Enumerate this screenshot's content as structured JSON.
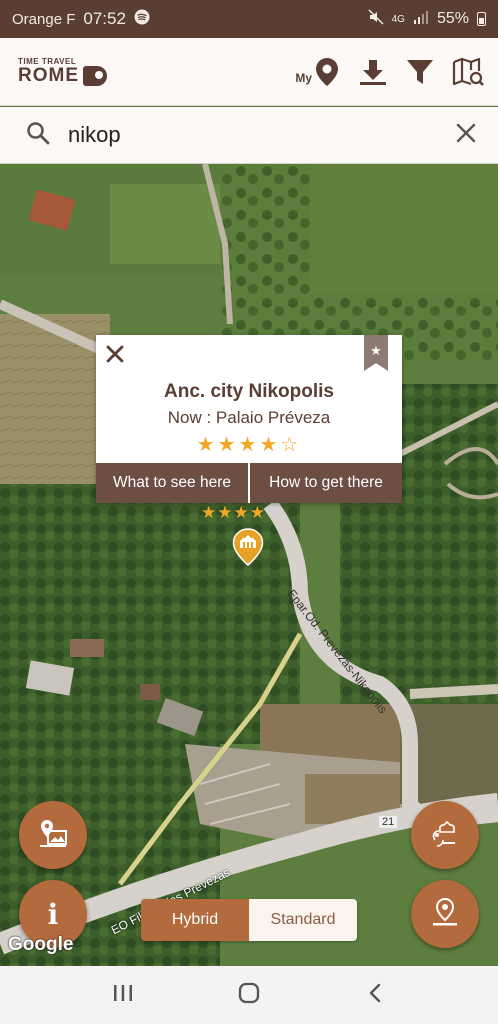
{
  "status_bar": {
    "carrier": "Orange F",
    "time": "07:52",
    "network": "4G",
    "battery": "55%"
  },
  "header": {
    "logo_top": "TIME TRAVEL",
    "logo_bottom": "ROME",
    "my_label": "My"
  },
  "search": {
    "value": "nikop"
  },
  "popup": {
    "title": "Anc. city Nikopolis",
    "now": "Now :  Palaio Préveza",
    "rating": 4,
    "rating_max": 5,
    "stars_text": "★★★★☆",
    "action_see": "What to see here",
    "action_get": "How to get there"
  },
  "site": {
    "stars_text": "★★★★"
  },
  "map": {
    "road_labels": [
      "Epar.Od. Prevezas-Nikopolis",
      "EO Filippiadas Prevezas",
      "21"
    ],
    "attribution": "Google",
    "map_type_selected": "Hybrid",
    "map_type_options": [
      "Hybrid",
      "Standard"
    ]
  },
  "colors": {
    "accent": "#b36a3c",
    "brand_dark": "#5a3e33",
    "star": "#f0a824"
  }
}
